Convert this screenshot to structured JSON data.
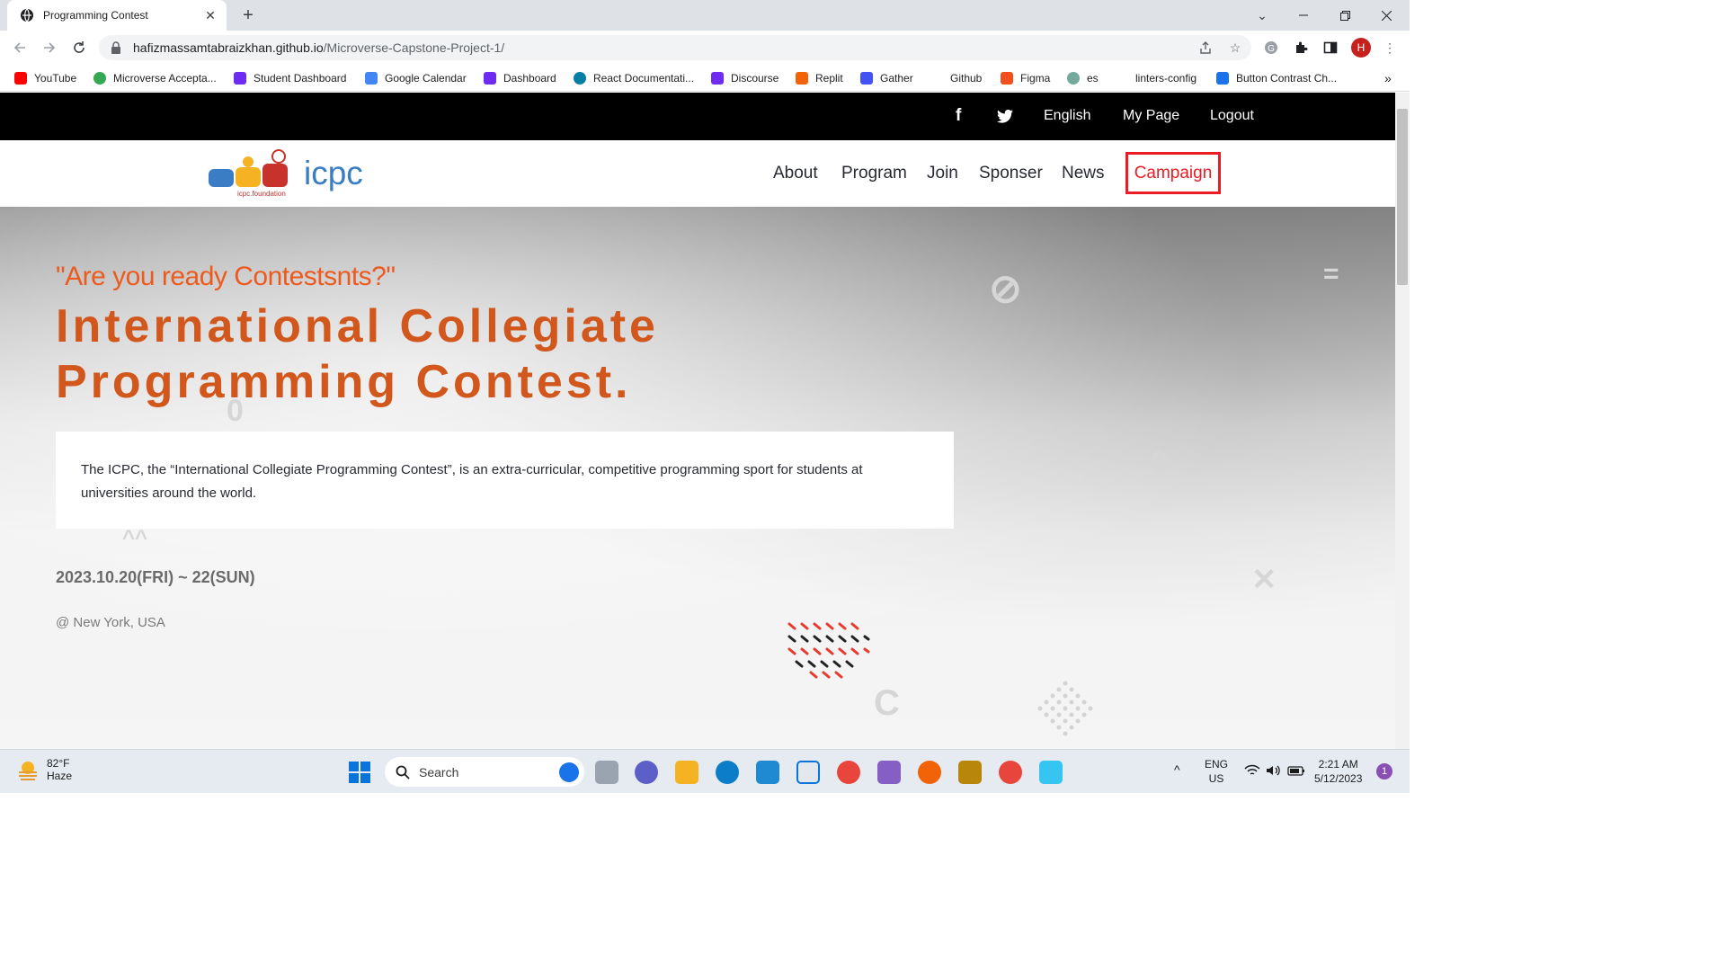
{
  "browser": {
    "tab_title": "Programming Contest",
    "tab_close": "✕",
    "new_tab": "+",
    "url_host": "hafizmassamtabraizkhan.github.io",
    "url_path": "/Microverse-Capstone-Project-1/",
    "profile_initial": "H"
  },
  "bookmarks": [
    {
      "label": "YouTube",
      "icon": "youtube-icon",
      "color": "#ff0000"
    },
    {
      "label": "Microverse Accepta...",
      "icon": "microverse-icon",
      "color": "#34a853"
    },
    {
      "label": "Student Dashboard",
      "icon": "dashboard-icon",
      "color": "#6e2cf2"
    },
    {
      "label": "Google Calendar",
      "icon": "calendar-icon",
      "color": "#4285f4"
    },
    {
      "label": "Dashboard",
      "icon": "microverse-m-icon",
      "color": "#6e2cf2"
    },
    {
      "label": "React Documentati...",
      "icon": "react-icon",
      "color": "#087ea4"
    },
    {
      "label": "Discourse",
      "icon": "discourse-icon",
      "color": "#6e2cf2"
    },
    {
      "label": "Replit",
      "icon": "replit-icon",
      "color": "#f26207"
    },
    {
      "label": "Gather",
      "icon": "gather-icon",
      "color": "#4352f5"
    },
    {
      "label": "Github",
      "icon": "",
      "color": "#ffffff"
    },
    {
      "label": "Figma",
      "icon": "figma-icon",
      "color": "#f24e1e"
    },
    {
      "label": "es",
      "icon": "chatgpt-icon",
      "color": "#74aa9c"
    },
    {
      "label": "linters-config",
      "icon": "",
      "color": "#ffffff"
    },
    {
      "label": "Button Contrast Ch...",
      "icon": "contrast-icon",
      "color": "#1a73e8"
    }
  ],
  "bookmarks_more": "»",
  "site": {
    "topbar": {
      "facebook": "f",
      "language": "English",
      "mypage": "My Page",
      "logout": "Logout"
    },
    "logo": {
      "text": "icpc",
      "sub": "icpc.foundation"
    },
    "nav": [
      "About",
      "Program",
      "Join",
      "Sponser",
      "News"
    ],
    "campaign": "Campaign",
    "hero": {
      "tagline": "\"Are you ready Contestsnts?\"",
      "title_line1": "International Collegiate",
      "title_line2": "Programming Contest.",
      "description": "The ICPC, the “International Collegiate Programming Contest”, is an extra-curricular, competitive programming sport for students at universities around the world.",
      "date": "2023.10.20(FRI) ~ 22(SUN)",
      "location": "@ New York, USA"
    },
    "colors": {
      "accent": "#ec5a1e",
      "campaign": "#ec1c24",
      "topbar": "#000000"
    }
  },
  "taskbar": {
    "weather_temp": "82°F",
    "weather_desc": "Haze",
    "search": "Search",
    "lang_top": "ENG",
    "lang_bottom": "US",
    "time": "2:21 AM",
    "date": "5/12/2023",
    "notifications": "1"
  }
}
